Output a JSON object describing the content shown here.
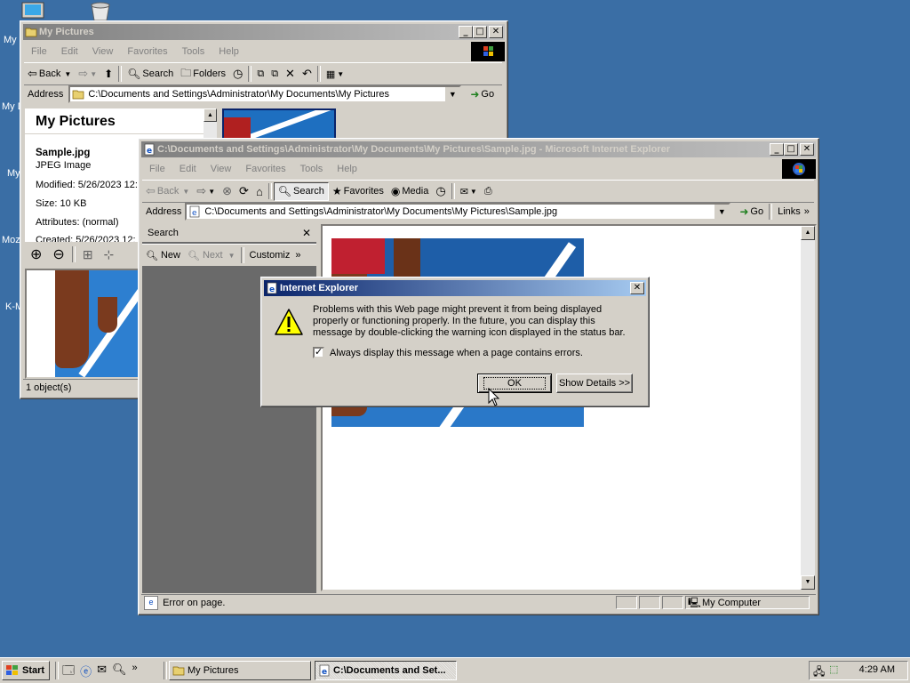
{
  "desktop": {
    "icon_labels": [
      "My",
      "My D",
      "My",
      "Moz",
      "K-M"
    ]
  },
  "explorer": {
    "title": "My Pictures",
    "menu": [
      "File",
      "Edit",
      "View",
      "Favorites",
      "Tools",
      "Help"
    ],
    "toolbar": {
      "back": "Back",
      "search": "Search",
      "folders": "Folders"
    },
    "address_label": "Address",
    "address_value": "C:\\Documents and Settings\\Administrator\\My Documents\\My Pictures",
    "go": "Go",
    "panel_title": "My Pictures",
    "file_name": "Sample.jpg",
    "file_type": "JPEG Image",
    "modified": "Modified: 5/26/2023 12:",
    "size": "Size: 10 KB",
    "attributes": "Attributes: (normal)",
    "created": "Created: 5/26/2023 12:",
    "status": "1 object(s)"
  },
  "ie": {
    "title": "C:\\Documents and Settings\\Administrator\\My Documents\\My Pictures\\Sample.jpg - Microsoft Internet Explorer",
    "menu": [
      "File",
      "Edit",
      "View",
      "Favorites",
      "Tools",
      "Help"
    ],
    "toolbar": {
      "back": "Back",
      "search": "Search",
      "favorites": "Favorites",
      "media": "Media"
    },
    "address_label": "Address",
    "address_value": "C:\\Documents and Settings\\Administrator\\My Documents\\My Pictures\\Sample.jpg",
    "go": "Go",
    "links": "Links",
    "search_pane": {
      "title": "Search",
      "new": "New",
      "next": "Next",
      "customize": "Customiz"
    },
    "status": "Error on page.",
    "zone": "My Computer"
  },
  "dialog": {
    "title": "Internet Explorer",
    "message": "Problems with this Web page might prevent it from being displayed properly or functioning properly. In the future, you can display this message by double-clicking the warning icon displayed in the status bar.",
    "checkbox_label": "Always display this message when a page contains errors.",
    "checkbox_checked": true,
    "ok": "OK",
    "details": "Show Details >>"
  },
  "taskbar": {
    "start": "Start",
    "tasks": [
      "My Pictures",
      "C:\\Documents and Set..."
    ],
    "clock": "4:29 AM"
  }
}
